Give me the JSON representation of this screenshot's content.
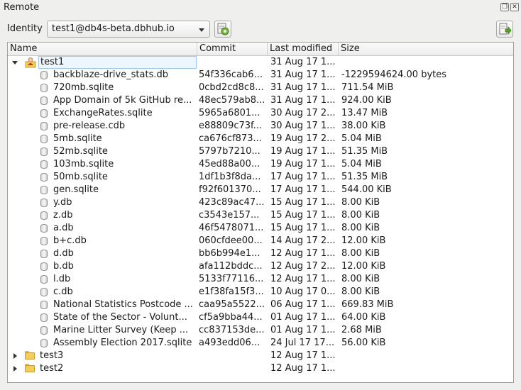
{
  "window": {
    "title": "Remote"
  },
  "identity": {
    "label": "Identity",
    "value": "test1@db4s-beta.dbhub.io"
  },
  "columns": {
    "name": "Name",
    "commit": "Commit",
    "modified": "Last modified",
    "size": "Size"
  },
  "tree": {
    "user": {
      "name": "test1",
      "modified": "31 Aug 17 1..."
    },
    "files": [
      {
        "name": "backblaze-drive_stats.db",
        "commit": "54f336cab6...",
        "modified": "31 Aug 17 1...",
        "size": "-1229594624.00 bytes"
      },
      {
        "name": "720mb.sqlite",
        "commit": "0cbd2cd8c8...",
        "modified": "31 Aug 17 1...",
        "size": "711.54 MiB"
      },
      {
        "name": "App Domain of 5k GitHub re...",
        "commit": "48ec579ab8...",
        "modified": "31 Aug 17 1...",
        "size": "924.00 KiB"
      },
      {
        "name": "ExchangeRates.sqlite",
        "commit": "5965a6801...",
        "modified": "30 Aug 17 2...",
        "size": "13.47 MiB"
      },
      {
        "name": "pre-release.cdb",
        "commit": "e88809c73f...",
        "modified": "30 Aug 17 1...",
        "size": "38.00 KiB"
      },
      {
        "name": "5mb.sqlite",
        "commit": "ca676cf873...",
        "modified": "19 Aug 17 2...",
        "size": "5.04 MiB"
      },
      {
        "name": "52mb.sqlite",
        "commit": "5797b7210...",
        "modified": "19 Aug 17 1...",
        "size": "51.35 MiB"
      },
      {
        "name": "103mb.sqlite",
        "commit": "45ed88a00...",
        "modified": "19 Aug 17 1...",
        "size": "5.04 MiB"
      },
      {
        "name": "50mb.sqlite",
        "commit": "1df1b3f8da...",
        "modified": "17 Aug 17 1...",
        "size": "51.35 MiB"
      },
      {
        "name": "gen.sqlite",
        "commit": "f92f601370...",
        "modified": "17 Aug 17 1...",
        "size": "544.00 KiB"
      },
      {
        "name": "y.db",
        "commit": "423c89ac47...",
        "modified": "15 Aug 17 1...",
        "size": "8.00 KiB"
      },
      {
        "name": "z.db",
        "commit": "c3543e157...",
        "modified": "15 Aug 17 1...",
        "size": "8.00 KiB"
      },
      {
        "name": "a.db",
        "commit": "46f5478071...",
        "modified": "15 Aug 17 1...",
        "size": "8.00 KiB"
      },
      {
        "name": "b+c.db",
        "commit": "060cfdee00...",
        "modified": "14 Aug 17 2...",
        "size": "12.00 KiB"
      },
      {
        "name": "d.db",
        "commit": "bb6b994e1...",
        "modified": "12 Aug 17 1...",
        "size": "8.00 KiB"
      },
      {
        "name": "b.db",
        "commit": "afa112bddc...",
        "modified": "12 Aug 17 2...",
        "size": "12.00 KiB"
      },
      {
        "name": "l.db",
        "commit": "5133f77116...",
        "modified": "12 Aug 17 1...",
        "size": "8.00 KiB"
      },
      {
        "name": "c.db",
        "commit": "e1f38fa15f3...",
        "modified": "10 Aug 17 0...",
        "size": "8.00 KiB"
      },
      {
        "name": "National Statistics Postcode ...",
        "commit": "caa95a5522...",
        "modified": "06 Aug 17 1...",
        "size": "669.83 MiB"
      },
      {
        "name": "State of the Sector - Volunt...",
        "commit": "cf5a9bba44...",
        "modified": "01 Aug 17 1...",
        "size": "64.00 KiB"
      },
      {
        "name": "Marine Litter Survey (Keep ...",
        "commit": "cc837153de...",
        "modified": "01 Aug 17 1...",
        "size": "2.68 MiB"
      },
      {
        "name": "Assembly Election 2017.sqlite",
        "commit": "a493edd06...",
        "modified": "24 Jul 17 17...",
        "size": "56.00 KiB"
      }
    ],
    "folders": [
      {
        "name": "test3",
        "modified": "12 Aug 17 1..."
      },
      {
        "name": "test2",
        "modified": "12 Aug 17 1..."
      }
    ]
  }
}
